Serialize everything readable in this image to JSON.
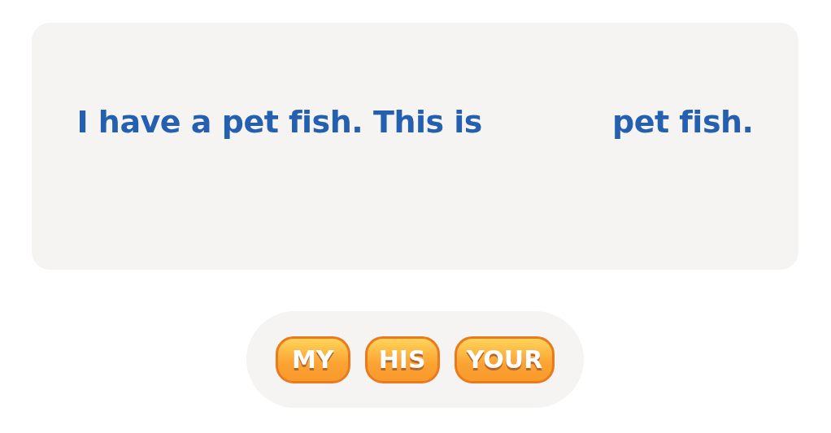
{
  "sentence": {
    "before": "I have a pet fish. This is",
    "after": "pet fish."
  },
  "choices": [
    {
      "label": "MY"
    },
    {
      "label": "HIS"
    },
    {
      "label": "YOUR"
    }
  ]
}
